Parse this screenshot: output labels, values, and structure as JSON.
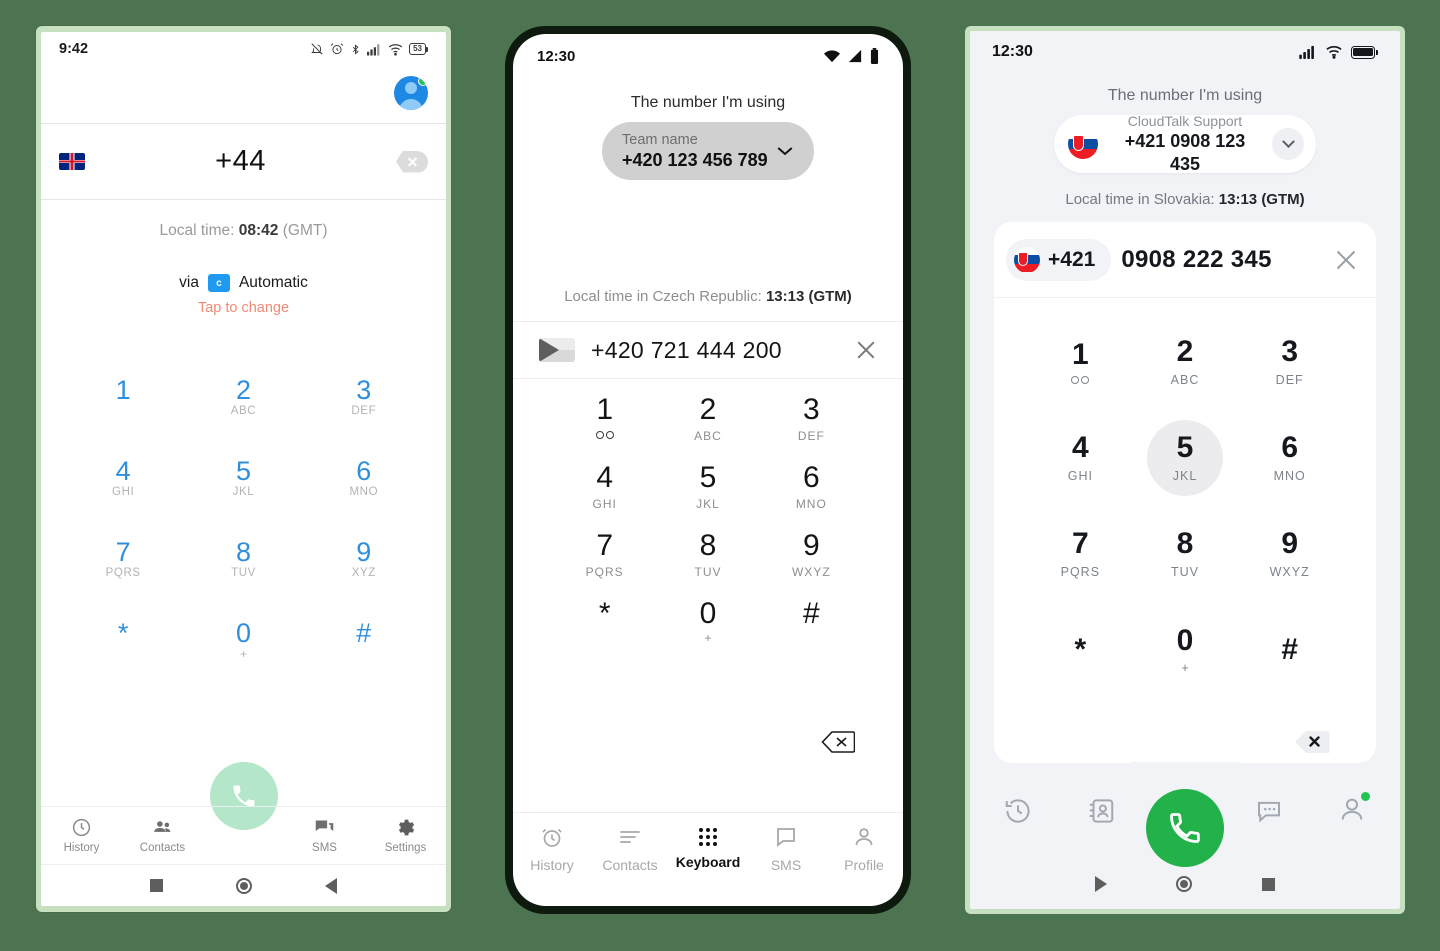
{
  "background_color": "#4d7450",
  "phone1": {
    "status_bar": {
      "time": "9:42",
      "icons": [
        "mute-icon",
        "alarm-icon",
        "bluetooth-icon",
        "signal-icon",
        "wifi-icon",
        "battery-icon"
      ],
      "battery_level": "53"
    },
    "avatar": {
      "name": "avatar",
      "online": true
    },
    "number_row": {
      "flag": "uk-flag",
      "number": "+44",
      "backspace": "backspace-icon"
    },
    "local_time": {
      "label": "Local time:",
      "value": "08:42",
      "zone": "(GMT)"
    },
    "via": {
      "prefix": "via",
      "badge": "c",
      "value": "Automatic",
      "hint": "Tap to change"
    },
    "keypad": [
      {
        "digit": "1",
        "sub": ""
      },
      {
        "digit": "2",
        "sub": "ABC"
      },
      {
        "digit": "3",
        "sub": "DEF"
      },
      {
        "digit": "4",
        "sub": "GHI"
      },
      {
        "digit": "5",
        "sub": "JKL"
      },
      {
        "digit": "6",
        "sub": "MNO"
      },
      {
        "digit": "7",
        "sub": "PQRS"
      },
      {
        "digit": "8",
        "sub": "TUV"
      },
      {
        "digit": "9",
        "sub": "XYZ"
      },
      {
        "digit": "*",
        "sub": ""
      },
      {
        "digit": "0",
        "sub": "+"
      },
      {
        "digit": "#",
        "sub": ""
      }
    ],
    "call_button": "call-button",
    "tabs": [
      {
        "label": "History",
        "icon": "clock-icon"
      },
      {
        "label": "Contacts",
        "icon": "contacts-icon"
      },
      {
        "label": "SMS",
        "icon": "sms-icon"
      },
      {
        "label": "Settings",
        "icon": "gear-icon"
      }
    ],
    "nav": [
      "recents-square-icon",
      "home-circle-icon",
      "back-triangle-icon"
    ],
    "accent_digit_color": "#2f8fdd",
    "call_button_color": "#b4e7c9"
  },
  "phone2": {
    "status_bar": {
      "time": "12:30",
      "icons": [
        "wifi-icon",
        "signal-icon",
        "battery-icon"
      ]
    },
    "title": "The number I'm using",
    "chip": {
      "label": "Team name",
      "number": "+420 123 456 789",
      "chevron": "chevron-down-icon"
    },
    "local_time": {
      "label": "Local time in Czech Republic:",
      "value": "13:13 (GTM)"
    },
    "input": {
      "flag": "czech-flag",
      "number": "+420 721 444 200",
      "clear": "close-icon"
    },
    "keypad": [
      {
        "digit": "1",
        "sub": "",
        "icon": "voicemail-icon"
      },
      {
        "digit": "2",
        "sub": "ABC"
      },
      {
        "digit": "3",
        "sub": "DEF"
      },
      {
        "digit": "4",
        "sub": "GHI"
      },
      {
        "digit": "5",
        "sub": "JKL"
      },
      {
        "digit": "6",
        "sub": "MNO"
      },
      {
        "digit": "7",
        "sub": "PQRS"
      },
      {
        "digit": "8",
        "sub": "TUV"
      },
      {
        "digit": "9",
        "sub": "WXYZ"
      },
      {
        "digit": "*",
        "sub": ""
      },
      {
        "digit": "0",
        "sub": "+"
      },
      {
        "digit": "#",
        "sub": ""
      }
    ],
    "backspace": "backspace-icon",
    "tabs": [
      {
        "label": "History",
        "icon": "alarm-clock-icon",
        "active": false
      },
      {
        "label": "Contacts",
        "icon": "list-icon",
        "active": false
      },
      {
        "label": "Keyboard",
        "icon": "dialpad-icon",
        "active": true
      },
      {
        "label": "SMS",
        "icon": "chat-icon",
        "active": false
      },
      {
        "label": "Profile",
        "icon": "person-icon",
        "active": false
      }
    ]
  },
  "phone3": {
    "status_bar": {
      "time": "12:30",
      "icons": [
        "signal-icon",
        "wifi-icon",
        "battery-icon"
      ]
    },
    "title": "The number I'm using",
    "chip": {
      "flag": "slovakia-flag",
      "label": "CloudTalk Support",
      "number": "+421 0908 123 435",
      "chevron": "chevron-down-icon"
    },
    "local_time": {
      "label": "Local time in Slovakia:",
      "value": "13:13 (GTM)"
    },
    "input": {
      "flag": "slovakia-flag",
      "country_code": "+421",
      "number": "0908 222 345",
      "clear": "close-icon"
    },
    "keypad": [
      {
        "digit": "1",
        "sub": "",
        "icon": "voicemail-icon",
        "pressed": false
      },
      {
        "digit": "2",
        "sub": "ABC",
        "pressed": false
      },
      {
        "digit": "3",
        "sub": "DEF",
        "pressed": false
      },
      {
        "digit": "4",
        "sub": "GHI",
        "pressed": false
      },
      {
        "digit": "5",
        "sub": "JKL",
        "pressed": true
      },
      {
        "digit": "6",
        "sub": "MNO",
        "pressed": false
      },
      {
        "digit": "7",
        "sub": "PQRS",
        "pressed": false
      },
      {
        "digit": "8",
        "sub": "TUV",
        "pressed": false
      },
      {
        "digit": "9",
        "sub": "WXYZ",
        "pressed": false
      },
      {
        "digit": "*",
        "sub": "",
        "pressed": false
      },
      {
        "digit": "0",
        "sub": "+",
        "pressed": false
      },
      {
        "digit": "#",
        "sub": "",
        "pressed": false
      }
    ],
    "backspace": "backspace-icon",
    "tabs": [
      {
        "icon": "history-icon"
      },
      {
        "icon": "contact-card-icon"
      },
      {
        "icon": "chat-bubble-icon"
      },
      {
        "icon": "person-icon"
      }
    ],
    "call_button": {
      "name": "call-button",
      "color": "#23b249"
    },
    "nav": [
      "back-triangle-icon",
      "home-circle-icon",
      "recents-square-icon"
    ]
  }
}
